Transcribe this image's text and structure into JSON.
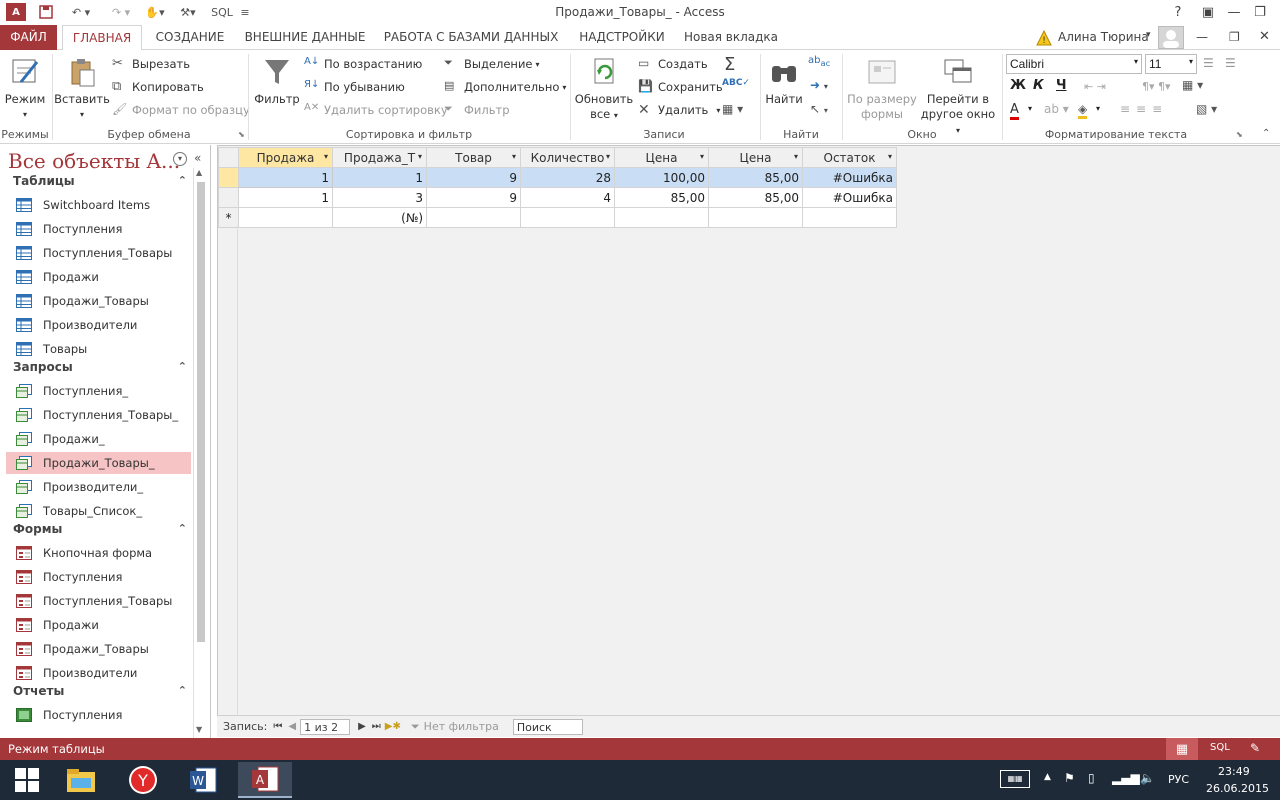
{
  "window": {
    "title": "Продажи_Товары_ - Access",
    "app_icon": "access-app-icon",
    "qat_sql": "SQL",
    "help": "?",
    "user": "Алина Тюрина"
  },
  "tabs": [
    {
      "label": "ФАЙЛ"
    },
    {
      "label": "ГЛАВНАЯ"
    },
    {
      "label": "СОЗДАНИЕ"
    },
    {
      "label": "ВНЕШНИЕ ДАННЫЕ"
    },
    {
      "label": "РАБОТА С БАЗАМИ ДАННЫХ"
    },
    {
      "label": "НАДСТРОЙКИ"
    },
    {
      "label": "Новая вкладка"
    }
  ],
  "ribbon": {
    "modes": {
      "view": "Режим",
      "group": "Режимы"
    },
    "clipboard": {
      "paste": "Вставить",
      "cut": "Вырезать",
      "copy": "Копировать",
      "format_painter": "Формат по образцу",
      "group": "Буфер обмена"
    },
    "sort": {
      "filter": "Фильтр",
      "asc": "По возрастанию",
      "desc": "По убыванию",
      "remove": "Удалить сортировку",
      "selection": "Выделение",
      "advanced": "Дополнительно",
      "toggle": "Фильтр",
      "group": "Сортировка и фильтр"
    },
    "records": {
      "refresh1": "Обновить",
      "refresh2": "все",
      "new": "Создать",
      "save": "Сохранить",
      "delete": "Удалить",
      "group": "Записи"
    },
    "find": {
      "find": "Найти",
      "group": "Найти"
    },
    "window": {
      "fit1": "По размеру",
      "fit2": "формы",
      "switch1": "Перейти в",
      "switch2": "другое окно",
      "group": "Окно"
    },
    "text": {
      "font": "Calibri",
      "size": "11",
      "bold": "Ж",
      "italic": "К",
      "underline": "Ч",
      "group": "Форматирование текста"
    }
  },
  "nav": {
    "title": "Все объекты A...",
    "sections": [
      {
        "label": "Таблицы",
        "items": [
          "Switchboard Items",
          "Поступления",
          "Поступления_Товары",
          "Продажи",
          "Продажи_Товары",
          "Производители",
          "Товары"
        ]
      },
      {
        "label": "Запросы",
        "items": [
          "Поступления_",
          "Поступления_Товары_",
          "Продажи_",
          "Продажи_Товары_",
          "Производители_",
          "Товары_Список_"
        ]
      },
      {
        "label": "Формы",
        "items": [
          "Кнопочная форма",
          "Поступления",
          "Поступления_Товары",
          "Продажи",
          "Продажи_Товары",
          "Производители"
        ]
      },
      {
        "label": "Отчеты",
        "items": [
          "Поступления"
        ]
      }
    ]
  },
  "datasheet": {
    "columns": [
      "Продажа",
      "Продажа_Т",
      "Товар",
      "Количество",
      "Цена",
      "Цена",
      "Остаток"
    ],
    "rows": [
      [
        "1",
        "1",
        "9",
        "28",
        "100,00",
        "85,00",
        "#Ошибка"
      ],
      [
        "1",
        "3",
        "9",
        "4",
        "85,00",
        "85,00",
        "#Ошибка"
      ]
    ],
    "new_row_marker": "*",
    "new_row_value": "(№)"
  },
  "record_nav": {
    "label": "Запись:",
    "position": "1 из 2",
    "filter": "Нет фильтра",
    "search": "Поиск"
  },
  "status": {
    "text": "Режим таблицы",
    "sql": "SQL"
  },
  "taskbar": {
    "lang": "РУС",
    "time": "23:49",
    "date": "26.06.2015"
  },
  "colors": {
    "accent": "#a4373a",
    "selected_row": "#c9def5",
    "header_selected": "#fde7a3",
    "taskbar": "#1f2a38"
  }
}
